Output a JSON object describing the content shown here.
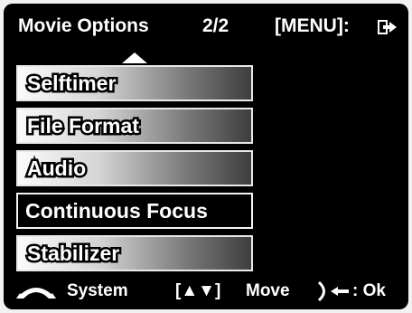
{
  "header": {
    "title": "Movie Options",
    "page": "2/2",
    "menu_hint": "[MENU]:"
  },
  "icons": {
    "exit": "exit-arrow-icon",
    "caret": "up-caret-icon",
    "system": "system-arch-icon",
    "ok": "dial-ok-icon"
  },
  "menu": {
    "items": [
      {
        "label": "Selftimer",
        "selected": false
      },
      {
        "label": "File Format",
        "selected": false
      },
      {
        "label": "Audio",
        "selected": false
      },
      {
        "label": "Continuous Focus",
        "selected": true
      },
      {
        "label": "Stabilizer",
        "selected": false
      }
    ]
  },
  "footer": {
    "system_label": "System",
    "nav_symbol": "[▲▼]",
    "move_label": "Move",
    "ok_label": ": Ok"
  },
  "colors": {
    "background": "#000000",
    "text": "#ffffff",
    "item_gradient_light": "#fbfbfb",
    "item_gradient_dark": "#3e3e3e"
  }
}
